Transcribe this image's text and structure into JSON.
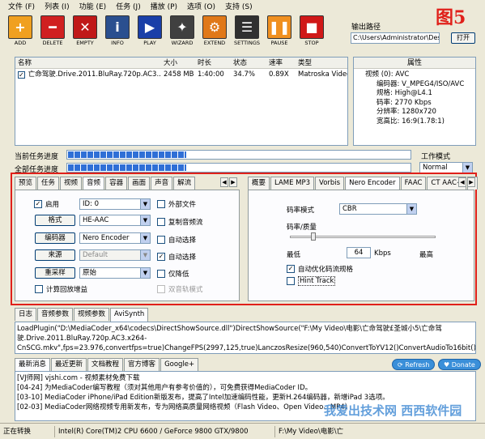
{
  "menu": [
    "文件 (F)",
    "列表 (I)",
    "功能 (E)",
    "任务 (J)",
    "播放 (P)",
    "选项 (O)",
    "支持 (S)"
  ],
  "watermark": "图5",
  "toolbar": [
    {
      "label": "ADD",
      "icon": "add-icon",
      "color": "#f0a020",
      "glyph": "+"
    },
    {
      "label": "DELETE",
      "icon": "delete-icon",
      "color": "#d02020",
      "glyph": "━"
    },
    {
      "label": "EMPTY",
      "icon": "empty-icon",
      "color": "#c01818",
      "glyph": "✕"
    },
    {
      "label": "INFO",
      "icon": "info-icon",
      "color": "#2a4f8f",
      "glyph": "i"
    },
    {
      "label": "PLAY",
      "icon": "play-icon",
      "color": "#1a3fa8",
      "glyph": "▶"
    },
    {
      "label": "WIZARD",
      "icon": "wizard-icon",
      "color": "#404040",
      "glyph": "✦"
    },
    {
      "label": "EXTEND",
      "icon": "extend-icon",
      "color": "#e07818",
      "glyph": "⚙"
    },
    {
      "label": "SETTINGS",
      "icon": "settings-icon",
      "color": "#303030",
      "glyph": "☰"
    },
    {
      "label": "PAUSE",
      "icon": "pause-icon",
      "color": "#f09020",
      "glyph": "❚❚"
    },
    {
      "label": "STOP",
      "icon": "stop-icon",
      "color": "#d01818",
      "glyph": "■"
    }
  ],
  "output": {
    "label": "输出路径",
    "path": "C:\\Users\\Administrator\\Desk",
    "open": "打开"
  },
  "filelist": {
    "headers": [
      "名称",
      "大小",
      "时长",
      "状态",
      "速率",
      "类型"
    ],
    "rows": [
      {
        "name": "亡命驾驶.Drive.2011.BluRay.720p.AC3....",
        "size": "2458 MB",
        "duration": "1:40:00",
        "status": "34.7%",
        "rate": "0.89X",
        "type": "Matroska Video"
      }
    ]
  },
  "props": {
    "title": "属性",
    "lines": [
      "视频 (0): AVC",
      "编码器: V_MPEG4/ISO/AVC",
      "规格: High@L4.1",
      "码率: 2770 Kbps",
      "分辨率: 1280x720",
      "宽高比: 16:9(1.78:1)"
    ]
  },
  "progress": {
    "current_label": "当前任务进度",
    "all_label": "全部任务进度",
    "current": 0.347,
    "all": 0.347
  },
  "workmode": {
    "label": "工作模式",
    "value": "Normal"
  },
  "left_tabs": [
    "预览",
    "任务",
    "视频",
    "音频",
    "容器",
    "画面",
    "声音",
    "解流"
  ],
  "right_tabs": [
    "概要",
    "LAME MP3",
    "Vorbis",
    "Nero Encoder",
    "FAAC",
    "CT AAC+",
    "("
  ],
  "audio": {
    "enable": "启用",
    "enable_value": "ID: 0",
    "format_btn": "格式",
    "format_value": "HE-AAC",
    "encoder_btn": "编码器",
    "encoder_value": "Nero Encoder",
    "source_btn": "来源",
    "source_value": "Default",
    "resample_btn": "重采样",
    "resample_value": "原始",
    "replaygain": "计算回放增益",
    "external": "外部文件",
    "copy": "复制音频流",
    "auto1": "自动选择",
    "auto2": "自动选择",
    "lowvol": "仅降低",
    "dualtrack": "双音轨模式"
  },
  "nero": {
    "mode_label": "码率模式",
    "mode_value": "CBR",
    "quality_label": "码率/质量",
    "min": "最低",
    "max": "最高",
    "kbps_value": "64",
    "kbps": "Kbps",
    "auto_opt": "自动优化码流规格",
    "hint": "Hint Track"
  },
  "bottom_tabs": [
    "日志",
    "音频参数",
    "视频参数",
    "AviSynth"
  ],
  "avisynth": "LoadPlugin(\"D:\\MediaCoder_x64\\codecs\\DirectShowSource.dll\")DirectShowSource(\"F:\\My Video\\电影\\亡命驾驶£圣城小5\\亡命驾驶.Drive.2011.BluRay.720p.AC3.x264-CnSCG.mkv\",fps=23.976,convertfps=true)ChangeFPS(2997,125,true)LanczosResize(960,540)ConvertToYV12()ConvertAudioTo16bit()",
  "news_tabs": [
    "最新消息",
    "最近更新",
    "文档教程",
    "官方博客",
    "Google+"
  ],
  "news_buttons": {
    "refresh": "Refresh",
    "donate": "Donate"
  },
  "news": [
    "[VJ师网] vjshi.com - 视频素材免费下载",
    "[04-24] 为MediaCoder编写教程（须对其他用户有参考价值的），可免费获得MediaCoder ID。",
    "[03-10] MediaCoder iPhone/iPad Edition新版发布，提高了Intel加速编码性能，更新H.264编码器，新增iPad 3选项。",
    "[02-03] MediaCoder网络视频专用新发布，专为网络高质量网络视频（Flash Video、Open Video、MP4）"
  ],
  "status": [
    "正在转换",
    "Intel(R) Core(TM)2 CPU 6600  / GeForce 9800 GTX/9800",
    "F:\\My Video\\电影\\亡"
  ],
  "site_watermark": "我爱出技术网 西西软件园"
}
